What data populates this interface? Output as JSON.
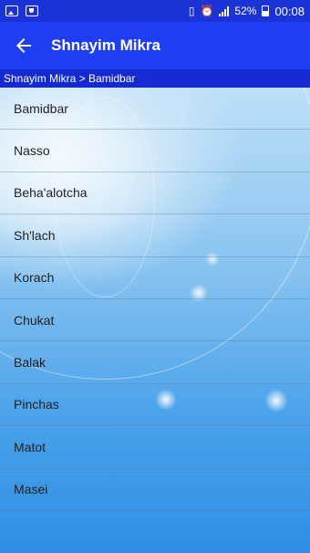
{
  "status_bar": {
    "battery_percent": "52%",
    "time": "00:08"
  },
  "app_bar": {
    "title": "Shnayim Mikra"
  },
  "breadcrumb": {
    "text": "Shnayim Mikra > Bamidbar"
  },
  "list": {
    "items": [
      {
        "label": "Bamidbar"
      },
      {
        "label": "Nasso"
      },
      {
        "label": "Beha'alotcha"
      },
      {
        "label": "Sh'lach"
      },
      {
        "label": "Korach"
      },
      {
        "label": "Chukat"
      },
      {
        "label": "Balak"
      },
      {
        "label": "Pinchas"
      },
      {
        "label": "Matot"
      },
      {
        "label": "Masei"
      }
    ]
  },
  "colors": {
    "status_bar": "#1a33d6",
    "app_bar": "#1f3df2",
    "breadcrumb": "#1429d0"
  }
}
